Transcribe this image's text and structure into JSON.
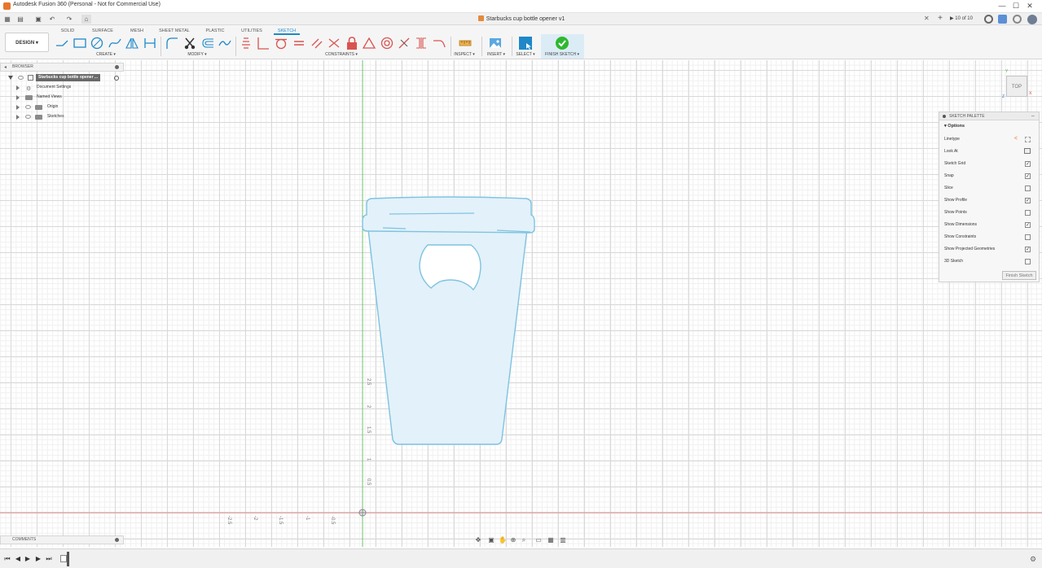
{
  "window": {
    "title": "Autodesk Fusion 360 (Personal - Not for Commercial Use)",
    "minimize": "—",
    "maximize": "☐",
    "close": "✕"
  },
  "qabar": {
    "doc_tab_title": "Starbucks cup bottle opener v1",
    "close_tab": "✕",
    "add_tab": "+",
    "job_status": "10 of 10"
  },
  "toolbar": {
    "workspace": "DESIGN ▾",
    "tabs": [
      "SOLID",
      "SURFACE",
      "MESH",
      "SHEET METAL",
      "PLASTIC",
      "UTILITIES",
      "SKETCH"
    ],
    "groups": {
      "create": "CREATE ▾",
      "modify": "MODIFY ▾",
      "constraints": "CONSTRAINTS ▾",
      "inspect": "INSPECT ▾",
      "insert": "INSERT ▾",
      "select": "SELECT ▾",
      "finish_sketch": "FINISH SKETCH ▾"
    }
  },
  "browser": {
    "title": "BROWSER",
    "root": "Starbucks cup bottle opener ...",
    "items": [
      "Document Settings",
      "Named Views",
      "Origin",
      "Sketches"
    ]
  },
  "comments": {
    "title": "COMMENTS"
  },
  "viewcube": {
    "face": "TOP"
  },
  "palette": {
    "title": "SKETCH PALETTE",
    "options_header": "Options",
    "rows": [
      {
        "label": "Linetype",
        "checked": ""
      },
      {
        "label": "Look At",
        "checked": ""
      },
      {
        "label": "Sketch Grid",
        "checked": "✓"
      },
      {
        "label": "Snap",
        "checked": "✓"
      },
      {
        "label": "Slice",
        "checked": ""
      },
      {
        "label": "Show Profile",
        "checked": "✓"
      },
      {
        "label": "Show Points",
        "checked": ""
      },
      {
        "label": "Show Dimensions",
        "checked": "✓"
      },
      {
        "label": "Show Constraints",
        "checked": ""
      },
      {
        "label": "Show Projected Geometries",
        "checked": "✓"
      },
      {
        "label": "3D Sketch",
        "checked": ""
      }
    ],
    "finish_button": "Finish Sketch"
  },
  "rulers": {
    "vertical": [
      "2.5",
      "2",
      "1.5",
      "1",
      "0.5"
    ],
    "horizontal": [
      "-2.5",
      "-2",
      "-1.5",
      "-1",
      "-0.5"
    ]
  },
  "colors": {
    "accent": "#1e88c8",
    "sketch_line": "#7ec3e0",
    "profile_fill": "#e3f1fa",
    "y_axis": "#6cc36c",
    "x_axis": "#e08a8a",
    "constraint_red": "#d9534f",
    "finish_green": "#2eb82e"
  },
  "icons": {
    "app": "fusion-logo-icon",
    "data_panel": "grid-icon",
    "file": "file-icon",
    "save": "save-icon",
    "undo": "undo-icon",
    "redo": "redo-icon",
    "home": "home-icon"
  }
}
